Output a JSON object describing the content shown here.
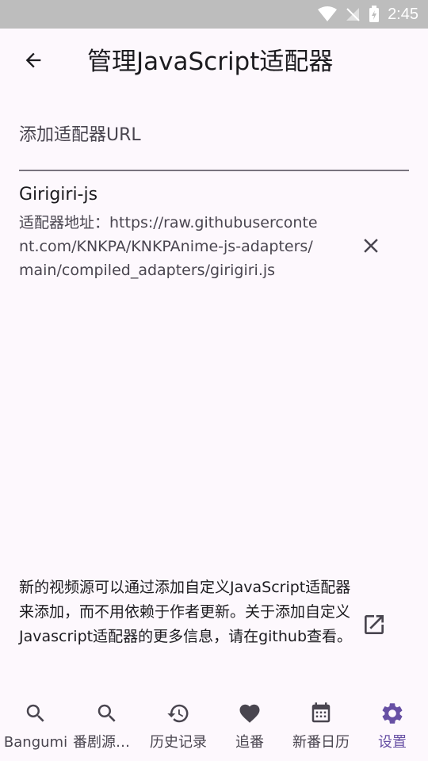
{
  "status_bar": {
    "time": "2:45"
  },
  "app_bar": {
    "title": "管理JavaScript适配器"
  },
  "add_adapter": {
    "placeholder": "添加适配器URL",
    "value": ""
  },
  "adapters": [
    {
      "name": "Girigiri-js",
      "url": "适配器地址：https://raw.githubusercontent.com/KNKPA/KNKPAnime-js-adapters/main/compiled_adapters/girigiri.js"
    }
  ],
  "info": {
    "text": "新的视频源可以通过添加自定义JavaScript适配器来添加，而不用依赖于作者更新。关于添加自定义Javascript适配器的更多信息，请在github查看。"
  },
  "bottom_nav": {
    "items": [
      {
        "label": "Bangumi",
        "icon": "search-icon"
      },
      {
        "label": "番剧源搜索",
        "icon": "search-icon"
      },
      {
        "label": "历史记录",
        "icon": "history-icon"
      },
      {
        "label": "追番",
        "icon": "heart-icon"
      },
      {
        "label": "新番日历",
        "icon": "calendar-icon"
      },
      {
        "label": "设置",
        "icon": "gear-icon"
      }
    ],
    "active_index": 5
  },
  "colors": {
    "accent": "#6750a4",
    "background": "#fdf8fd",
    "status_bar": "#bdbdbd",
    "icon": "#49454f"
  }
}
